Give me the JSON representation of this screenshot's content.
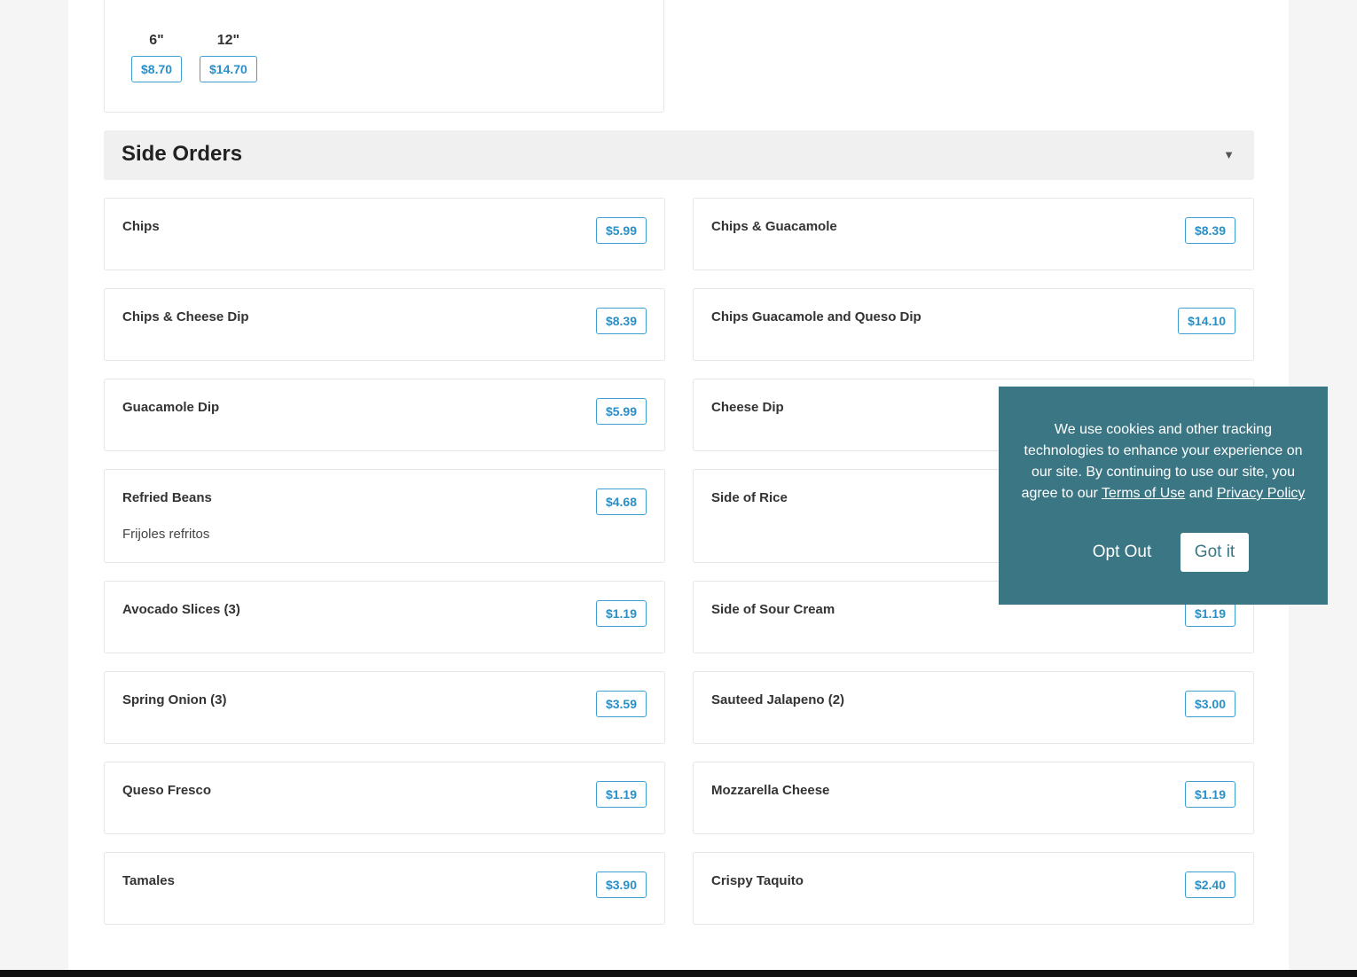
{
  "top_item": {
    "sizes": [
      {
        "label": "6\"",
        "price": "$8.70"
      },
      {
        "label": "12\"",
        "price": "$14.70"
      }
    ]
  },
  "section": {
    "title": "Side Orders",
    "chevron": "▼"
  },
  "items": [
    {
      "name": "Chips",
      "price": "$5.99",
      "desc": ""
    },
    {
      "name": "Chips & Guacamole",
      "price": "$8.39",
      "desc": ""
    },
    {
      "name": "Chips & Cheese Dip",
      "price": "$8.39",
      "desc": ""
    },
    {
      "name": "Chips Guacamole and Queso Dip",
      "price": "$14.10",
      "desc": ""
    },
    {
      "name": "Guacamole Dip",
      "price": "$5.99",
      "desc": ""
    },
    {
      "name": "Cheese Dip",
      "price": "",
      "desc": ""
    },
    {
      "name": "Refried Beans",
      "price": "$4.68",
      "desc": "Frijoles refritos"
    },
    {
      "name": "Side of Rice",
      "price": "",
      "desc": ""
    },
    {
      "name": "Avocado Slices (3)",
      "price": "$1.19",
      "desc": ""
    },
    {
      "name": "Side of Sour Cream",
      "price": "$1.19",
      "desc": ""
    },
    {
      "name": "Spring Onion (3)",
      "price": "$3.59",
      "desc": ""
    },
    {
      "name": "Sauteed Jalapeno (2)",
      "price": "$3.00",
      "desc": ""
    },
    {
      "name": "Queso Fresco",
      "price": "$1.19",
      "desc": ""
    },
    {
      "name": "Mozzarella Cheese",
      "price": "$1.19",
      "desc": ""
    },
    {
      "name": "Tamales",
      "price": "$3.90",
      "desc": ""
    },
    {
      "name": "Crispy Taquito",
      "price": "$2.40",
      "desc": ""
    }
  ],
  "cookie": {
    "text_before": "We use cookies and other tracking technologies to enhance your experience on our site. By continuing to use our site, you agree to our ",
    "terms_link": "Terms of Use",
    "and_text": " and ",
    "privacy_link": "Privacy Policy",
    "opt_out": "Opt Out",
    "got_it": "Got it",
    "bg_color": "#3a7684"
  },
  "colors": {
    "price_accent": "#2b8fc7"
  }
}
